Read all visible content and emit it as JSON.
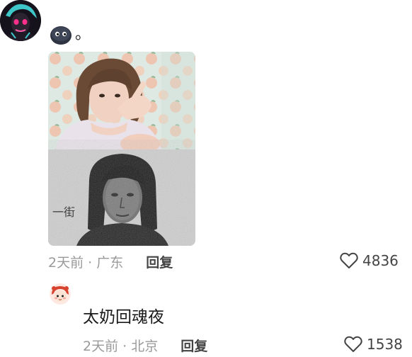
{
  "comment": {
    "text": "。",
    "emoji_icon": "dark-blob-emoji-icon",
    "time_location": "2天前 · 广东",
    "reply_label": "回复",
    "like_count": "4836",
    "image": {
      "top_panel": "photo of young woman with short hair touching lips",
      "bottom_panel": "grainy black-and-white ID-style portrait photo"
    }
  },
  "reply": {
    "text": "太奶回魂夜",
    "time_location": "2天前 · 北京",
    "reply_label": "回复",
    "like_count": "1538"
  },
  "colors": {
    "meta_gray": "#9a9a9a",
    "reply_label": "#444444",
    "text": "#1a1a1a",
    "background": "#ffffff"
  }
}
